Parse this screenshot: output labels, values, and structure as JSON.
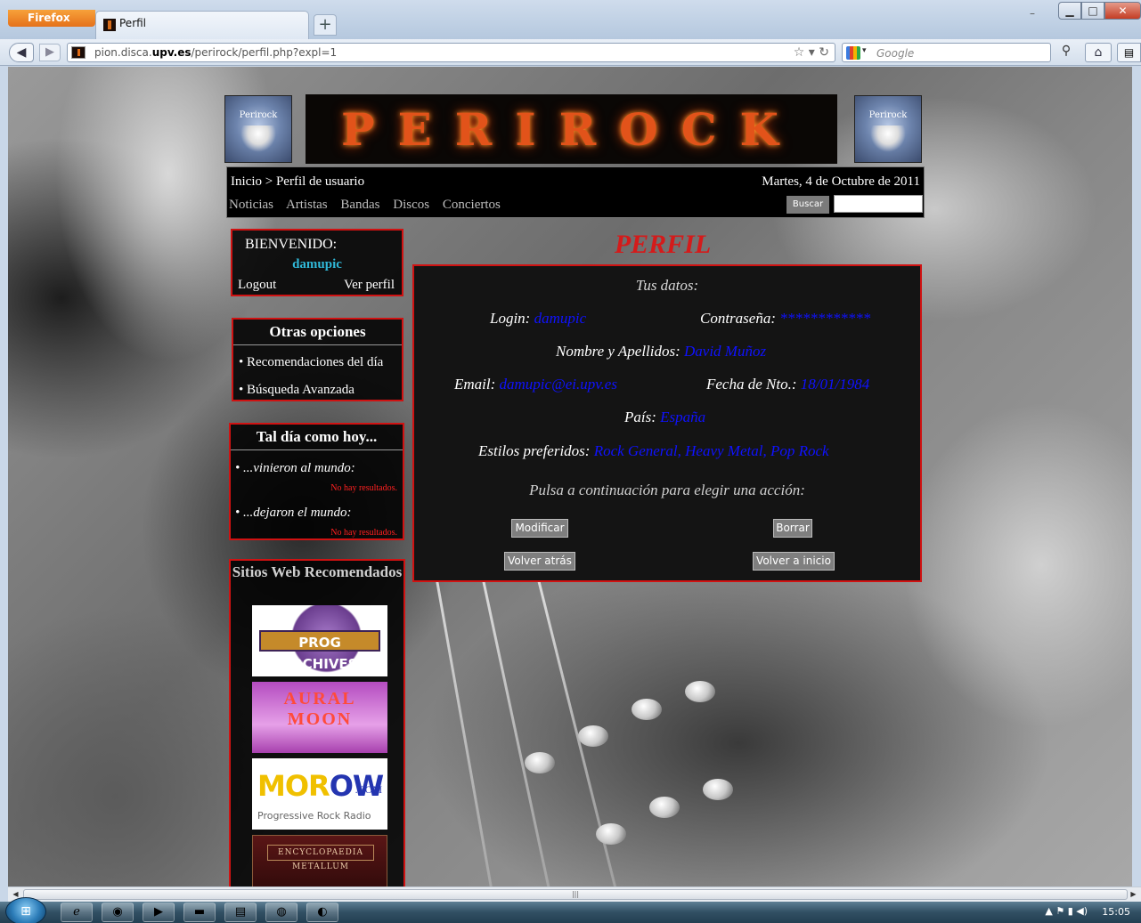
{
  "browser": {
    "menu_label": "Firefox",
    "tab_title": "Perfil",
    "new_tab_label": "+",
    "url_prefix": "pion.disca.",
    "url_domain": "upv.es",
    "url_path": "/perirock/perfil.php?expl=1",
    "search_placeholder": "Google"
  },
  "site": {
    "logo_text": "PERIROCK",
    "side_logo_text": "Perirock",
    "breadcrumb": "Inicio > Perfil de usuario",
    "date": "Martes, 4 de Octubre de 2011",
    "menu": [
      "Noticias",
      "Artistas",
      "Bandas",
      "Discos",
      "Conciertos"
    ],
    "search_button": "Buscar"
  },
  "welcome": {
    "title": "BIENVENIDO:",
    "username": "damupic",
    "logout": "Logout",
    "view_profile": "Ver perfil"
  },
  "otras": {
    "title": "Otras opciones",
    "items": [
      "Recomendaciones del día",
      "Búsqueda Avanzada"
    ]
  },
  "taldia": {
    "title": "Tal día como hoy...",
    "born": "...vinieron al mundo:",
    "died": "...dejaron el mundo:",
    "no_results": "No hay resultados."
  },
  "sitios": {
    "title": "Sitios Web Recomendados",
    "banners": {
      "prog": "PROG ARCHIVES",
      "aural": "AURAL MOON",
      "morow_a": "MOR",
      "morow_b": "OW",
      "morow_com": ".COM",
      "morow_sub": "Progressive Rock Radio",
      "metal": "ENCYCLOPAEDIA METALLUM"
    }
  },
  "perfil": {
    "title": "PERFIL",
    "tus_datos": "Tus datos:",
    "login_label": "Login:",
    "login_value": "damupic",
    "pass_label": "Contraseña:",
    "pass_value": "************",
    "nombre_label": "Nombre y Apellidos:",
    "nombre_value": "David Muñoz",
    "email_label": "Email:",
    "email_value": "damupic@ei.upv.es",
    "fecha_label": "Fecha de Nto.:",
    "fecha_value": "18/01/1984",
    "pais_label": "País:",
    "pais_value": "España",
    "estilos_label": "Estilos preferidos:",
    "estilos_value": "Rock General, Heavy Metal, Pop Rock",
    "accion_text": "Pulsa a continuación para elegir una acción:",
    "buttons": {
      "modificar": "Modificar",
      "borrar": "Borrar",
      "volver": "Volver atrás",
      "inicio": "Volver a inicio"
    }
  },
  "taskbar": {
    "clock": "15:05"
  }
}
